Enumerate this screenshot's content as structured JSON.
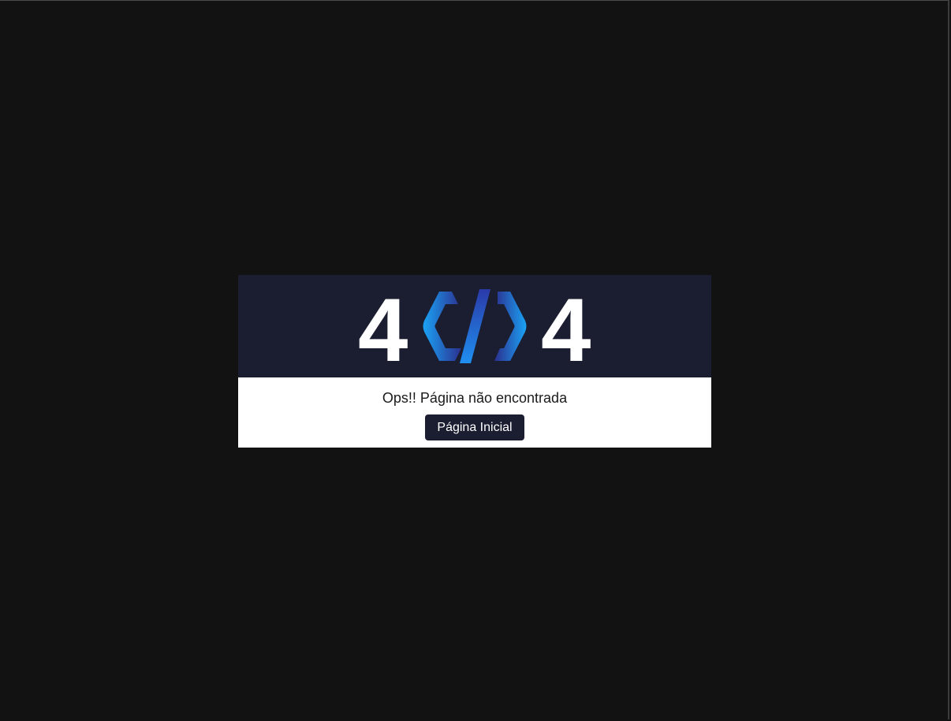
{
  "error": {
    "digit_left": "4",
    "digit_right": "4",
    "logo_icon": "code-brackets-icon",
    "message": "Ops!! Página não encontrada",
    "home_button_label": "Página Inicial"
  },
  "colors": {
    "background": "#121212",
    "banner": "#1b1d31",
    "button": "#1b1d31",
    "logo_gradient_start": "#2a3aa8",
    "logo_gradient_end": "#1aa3f5"
  }
}
